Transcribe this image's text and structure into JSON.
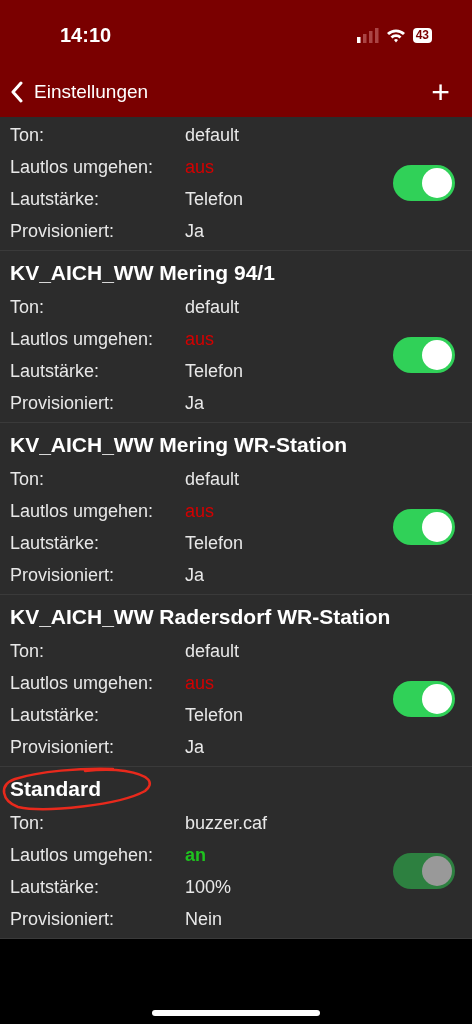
{
  "status_bar": {
    "time": "14:10",
    "battery": "43"
  },
  "nav_bar": {
    "back_label": "Einstellungen",
    "add_label": "+"
  },
  "sections": [
    {
      "toggle_on": true,
      "disabled": false,
      "rows": [
        {
          "kind": "plain",
          "label": "Ton:",
          "value": "default"
        },
        {
          "kind": "status",
          "label": "Lautlos umgehen:",
          "value": "aus",
          "on": false
        },
        {
          "kind": "plain",
          "label": "Lautstärke:",
          "value": "Telefon"
        },
        {
          "kind": "plain",
          "label": "Provisioniert:",
          "value": "Ja"
        }
      ]
    },
    {
      "title": "KV_AICH_WW Mering 94/1",
      "toggle_on": true,
      "disabled": false,
      "rows": [
        {
          "kind": "plain",
          "label": "Ton:",
          "value": "default"
        },
        {
          "kind": "status",
          "label": "Lautlos umgehen:",
          "value": "aus",
          "on": false
        },
        {
          "kind": "plain",
          "label": "Lautstärke:",
          "value": "Telefon"
        },
        {
          "kind": "plain",
          "label": "Provisioniert:",
          "value": "Ja"
        }
      ]
    },
    {
      "title": "KV_AICH_WW Mering WR-Station",
      "toggle_on": true,
      "disabled": false,
      "rows": [
        {
          "kind": "plain",
          "label": "Ton:",
          "value": "default"
        },
        {
          "kind": "status",
          "label": "Lautlos umgehen:",
          "value": "aus",
          "on": false
        },
        {
          "kind": "plain",
          "label": "Lautstärke:",
          "value": "Telefon"
        },
        {
          "kind": "plain",
          "label": "Provisioniert:",
          "value": "Ja"
        }
      ]
    },
    {
      "title": "KV_AICH_WW Radersdorf WR-Station",
      "toggle_on": true,
      "disabled": false,
      "rows": [
        {
          "kind": "plain",
          "label": "Ton:",
          "value": "default"
        },
        {
          "kind": "status",
          "label": "Lautlos umgehen:",
          "value": "aus",
          "on": false
        },
        {
          "kind": "plain",
          "label": "Lautstärke:",
          "value": "Telefon"
        },
        {
          "kind": "plain",
          "label": "Provisioniert:",
          "value": "Ja"
        }
      ]
    },
    {
      "title": "Standard",
      "toggle_on": true,
      "disabled": true,
      "circled": true,
      "rows": [
        {
          "kind": "plain",
          "label": "Ton:",
          "value": "buzzer.caf"
        },
        {
          "kind": "status",
          "label": "Lautlos umgehen:",
          "value": "an",
          "on": true
        },
        {
          "kind": "plain",
          "label": "Lautstärke:",
          "value": "100%"
        },
        {
          "kind": "plain",
          "label": "Provisioniert:",
          "value": "Nein"
        }
      ]
    }
  ]
}
